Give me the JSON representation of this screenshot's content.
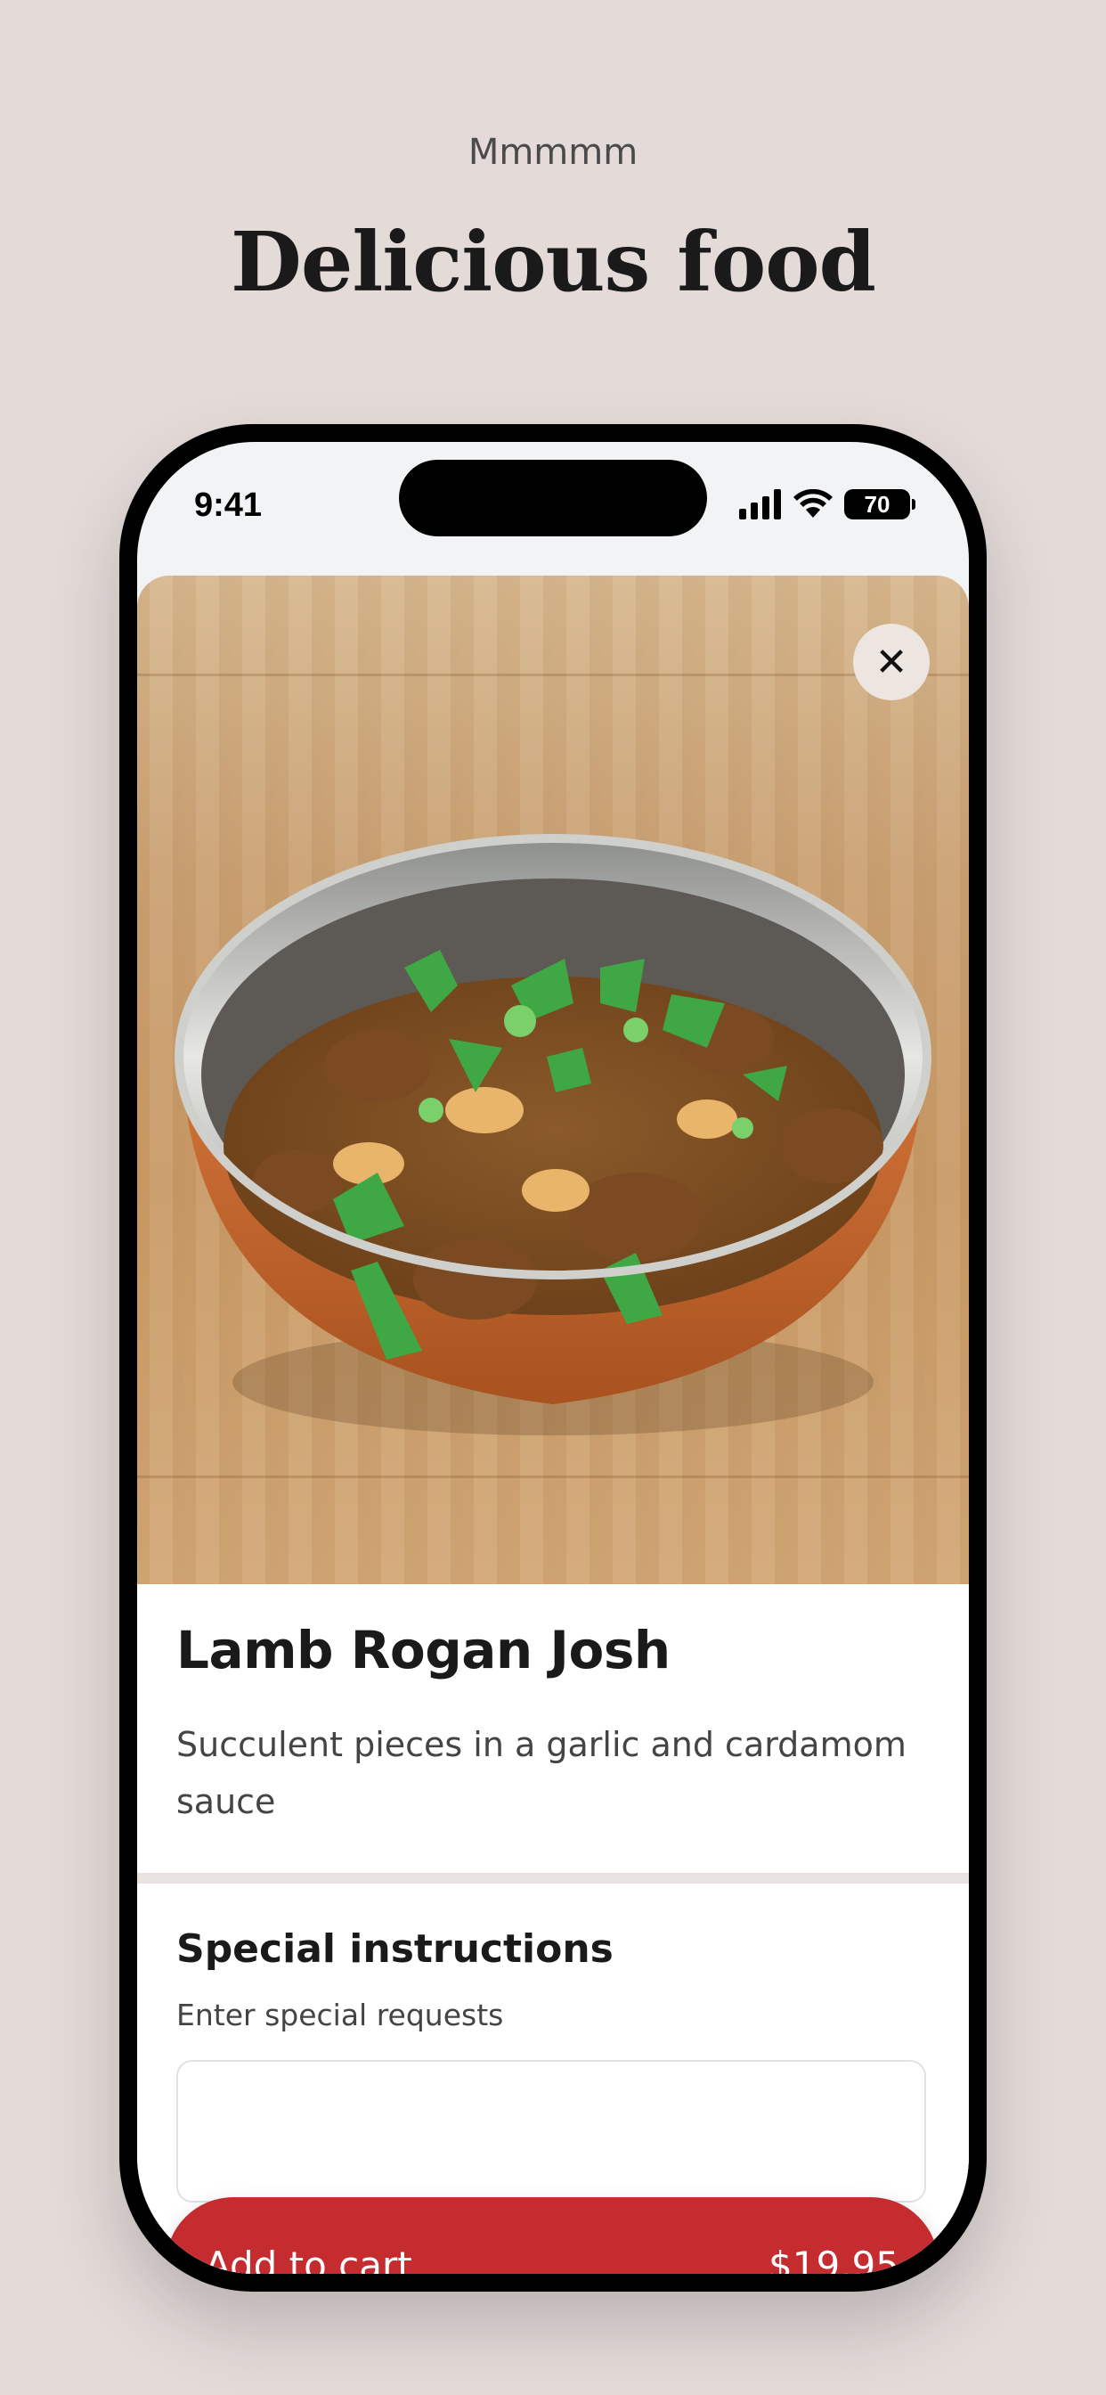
{
  "marketing": {
    "eyebrow": "Mmmmm",
    "headline": "Delicious food"
  },
  "status_bar": {
    "time": "9:41",
    "battery": "70",
    "icons": [
      "signal-icon",
      "wifi-icon",
      "battery-icon"
    ]
  },
  "item": {
    "image_alt": "curry-in-copper-bowl-photo",
    "name": "Lamb Rogan Josh",
    "description": "Succulent pieces in a garlic and cardamom sauce"
  },
  "close_icon": "close-icon",
  "special_instructions": {
    "title": "Special instructions",
    "subtitle": "Enter special requests",
    "value": ""
  },
  "cart": {
    "label": "Add to cart",
    "price": "$19.95"
  },
  "colors": {
    "background": "#e4dbd9",
    "accent": "#c52c2f"
  }
}
